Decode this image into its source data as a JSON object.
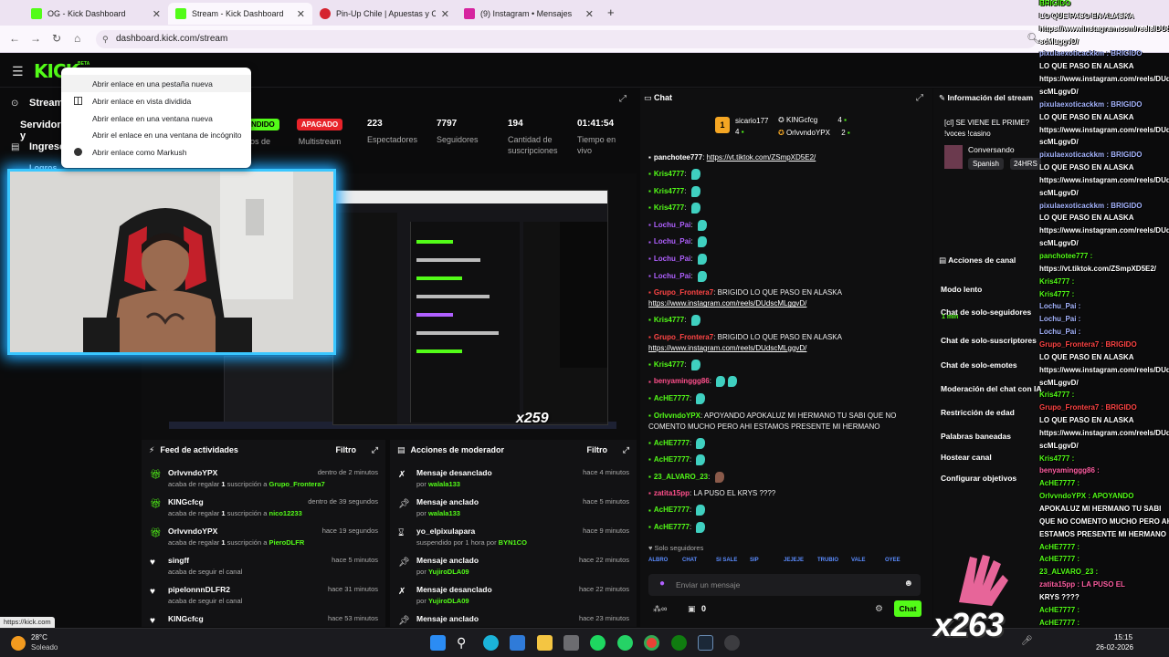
{
  "browser": {
    "tabs": [
      {
        "title": "OG - Kick Dashboard",
        "color": "#53fc18"
      },
      {
        "title": "Stream - Kick Dashboard",
        "color": "#53fc18"
      },
      {
        "title": "Pin-Up Chile | Apuestas y Casin",
        "color": "#d5232f"
      },
      {
        "title": "(9) Instagram • Mensajes",
        "color": "#d6249f"
      }
    ],
    "new_tab": "+",
    "url": "dashboard.kick.com/stream"
  },
  "kick": {
    "logo": "KICK",
    "logo_badge": "BETA",
    "sidebar": [
      "Stream",
      "Servidor y",
      "Ingresos",
      "Logros"
    ]
  },
  "context_menu": {
    "items": [
      "Abrir enlace en una pestaña nueva",
      "Abrir enlace en vista dividida",
      "Abrir enlace en una ventana nueva",
      "Abrir el enlace en una ventana de incógnito",
      "Abrir enlace como Markush"
    ]
  },
  "stats": {
    "partial_status": "NDIDO",
    "partial_label": "os de",
    "multistream_badge": "APAGADO",
    "multistream_label": "Multistream",
    "viewers": "223",
    "viewers_label": "Espectadores",
    "followers": "7797",
    "followers_label": "Seguidores",
    "subs": "194",
    "subs_label": "Cantidad de suscripciones",
    "uptime": "01:41:54",
    "uptime_label": "Tiempo en vivo"
  },
  "preview": {
    "overlay_counter": "x259"
  },
  "activity_feed": {
    "title": "Feed de actividades",
    "filter": "Filtro",
    "items": [
      {
        "user": "OrlvvndoYPX",
        "time": "dentro de 2 minutos",
        "text": "acaba de regalar ",
        "bold": "1",
        "text2": " suscripción a ",
        "target": "Grupo_Frontera7",
        "icon": "gift-icon"
      },
      {
        "user": "KINGcfcg",
        "time": "dentro de 39 segundos",
        "text": "acaba de regalar ",
        "bold": "1",
        "text2": " suscripción a ",
        "target": "nico12233",
        "icon": "gift-icon"
      },
      {
        "user": "OrlvvndoYPX",
        "time": "hace 19 segundos",
        "text": "acaba de regalar ",
        "bold": "1",
        "text2": " suscripción a ",
        "target": "PieroDLFR",
        "icon": "gift-icon"
      },
      {
        "user": "singff",
        "time": "hace 5 minutos",
        "text": "acaba de seguir el canal",
        "bold": "",
        "text2": "",
        "target": "",
        "icon": "heart-icon"
      },
      {
        "user": "pipelonnnDLFR2",
        "time": "hace 31 minutos",
        "text": "acaba de seguir el canal",
        "bold": "",
        "text2": "",
        "target": "",
        "icon": "heart-icon"
      },
      {
        "user": "KINGcfcg",
        "time": "hace 53 minutos",
        "text": "",
        "bold": "",
        "text2": "",
        "target": "",
        "icon": "heart-icon"
      }
    ]
  },
  "mod_actions": {
    "title": "Acciones de moderador",
    "filter": "Filtro",
    "items": [
      {
        "title": "Mensaje desanclado",
        "time": "hace 4 minutos",
        "by": "por ",
        "user": "walala133",
        "icon": "unpin-icon"
      },
      {
        "title": "Mensaje anclado",
        "time": "hace 5 minutos",
        "by": "por ",
        "user": "walala133",
        "icon": "pin-icon"
      },
      {
        "title": "yo_elpixulapara",
        "time": "hace 9 minutos",
        "by": "suspendido por 1 hora por ",
        "user": "BYN1CO",
        "icon": "hourglass-icon"
      },
      {
        "title": "Mensaje anclado",
        "time": "hace 22 minutos",
        "by": "por ",
        "user": "YujiroDLA09",
        "icon": "pin-icon"
      },
      {
        "title": "Mensaje desanclado",
        "time": "hace 22 minutos",
        "by": "por ",
        "user": "YujiroDLA09",
        "icon": "unpin-icon"
      },
      {
        "title": "Mensaje anclado",
        "time": "hace 23 minutos",
        "by": "",
        "user": "",
        "icon": "pin-icon"
      }
    ]
  },
  "chat": {
    "title": "Chat",
    "top_gifters": [
      {
        "name": "sicario177",
        "count": "4"
      },
      {
        "name": "KINGcfcg",
        "count": "4"
      },
      {
        "name": "OrlvvndoYPX",
        "count": "2"
      }
    ],
    "top_rank": "1",
    "lines": [
      {
        "user": "panchotee777",
        "color": "#ffffff",
        "sep": ": ",
        "text": "https://vt.tiktok.com/ZSmpXD5E2/",
        "link": true,
        "emotes": 0
      },
      {
        "user": "Kris4777",
        "color": "#53fc18",
        "sep": ": ",
        "text": "",
        "link": false,
        "emotes": 1
      },
      {
        "user": "Kris4777",
        "color": "#53fc18",
        "sep": ": ",
        "text": "",
        "link": false,
        "emotes": 1
      },
      {
        "user": "Kris4777",
        "color": "#53fc18",
        "sep": ": ",
        "text": "",
        "link": false,
        "emotes": 1
      },
      {
        "user": "Lochu_Pai",
        "color": "#b060ff",
        "sep": ": ",
        "text": "",
        "link": false,
        "emotes": 1
      },
      {
        "user": "Lochu_Pai",
        "color": "#b060ff",
        "sep": ": ",
        "text": "",
        "link": false,
        "emotes": 1
      },
      {
        "user": "Lochu_Pai",
        "color": "#b060ff",
        "sep": ": ",
        "text": "",
        "link": false,
        "emotes": 1
      },
      {
        "user": "Lochu_Pai",
        "color": "#b060ff",
        "sep": ": ",
        "text": "",
        "link": false,
        "emotes": 1
      },
      {
        "user": "Grupo_Frontera7",
        "color": "#ff4545",
        "sep": ": ",
        "text": "BRIGIDO LO QUE PASO EN ALASKA",
        "text2": "https://www.instagram.com/reels/DUdscMLggvD/",
        "link": false,
        "emotes": 0
      },
      {
        "user": "Kris4777",
        "color": "#53fc18",
        "sep": ": ",
        "text": "",
        "link": false,
        "emotes": 1
      },
      {
        "user": "Grupo_Frontera7",
        "color": "#ff4545",
        "sep": ": ",
        "text": "BRIGIDO LO QUE PASO EN ALASKA",
        "text2": "https://www.instagram.com/reels/DUdscMLggvD/",
        "link": false,
        "emotes": 0
      },
      {
        "user": "Kris4777",
        "color": "#53fc18",
        "sep": ": ",
        "text": "",
        "link": false,
        "emotes": 1
      },
      {
        "user": "benyaminggg86",
        "color": "#ff4f8b",
        "sep": ": ",
        "text": "",
        "link": false,
        "emotes": 1
      },
      {
        "user": "AcHE7777",
        "color": "#53fc18",
        "sep": ": ",
        "text": "",
        "link": false,
        "emotes": 1
      },
      {
        "user": "OrlvvndoYPX",
        "color": "#53fc18",
        "sep": ": ",
        "text": "APOYANDO APOKALUZ MI HERMANO TU SABI QUE NO",
        "text2": "COMENTO MUCHO PERO AHI ESTAMOS PRESENTE MI HERMANO",
        "link": false,
        "emotes": 0
      },
      {
        "user": "AcHE7777",
        "color": "#53fc18",
        "sep": ": ",
        "text": "",
        "link": false,
        "emotes": 1
      },
      {
        "user": "AcHE7777",
        "color": "#53fc18",
        "sep": ": ",
        "text": "",
        "link": false,
        "emotes": 1
      },
      {
        "user": "23_ALVARO_23",
        "color": "#53fc18",
        "sep": ": ",
        "text": "",
        "link": false,
        "emotes": 1
      },
      {
        "user": "zatita15pp",
        "color": "#ff4f8b",
        "sep": ": ",
        "text": "LA PUSO EL KRYS ????",
        "link": false,
        "emotes": 0
      },
      {
        "user": "AcHE7777",
        "color": "#53fc18",
        "sep": ": ",
        "text": "",
        "link": false,
        "emotes": 1
      },
      {
        "user": "AcHE7777",
        "color": "#53fc18",
        "sep": ": ",
        "text": "",
        "link": false,
        "emotes": 1
      }
    ],
    "followers_only": "Solo seguidores",
    "emote_row": [
      "ALBRO",
      "CHAT",
      "SI SALE",
      "SIP",
      "JEJEJE",
      "TRUBIO",
      "VALE",
      "OYEE"
    ],
    "input_placeholder": "Enviar un mensaje",
    "viewers_small": "0",
    "send": "Chat"
  },
  "info": {
    "title": "Información del stream",
    "stream_title": "[cl] SE VIENE EL PRIME? !voces !casino",
    "category": "Conversando",
    "language": "Spanish",
    "tag": "24HRS",
    "actions_title": "Acciones de canal",
    "actions": [
      "Modo lento",
      "Chat de solo-seguidores",
      "Chat de solo-suscriptores",
      "Chat de solo-emotes",
      "Moderación del chat con IA",
      "Restricción de edad",
      "Palabras baneadas",
      "Hostear canal",
      "Configurar objetivos"
    ],
    "followers_only_value": "1 min"
  },
  "overlay_chat": [
    {
      "u": "BRIGIDO",
      "c": "gr"
    },
    {
      "u": "LO QUE PASO EN ALASKA",
      "c": ""
    },
    {
      "u": "https://www.instagram.com/reels/DUd",
      "c": ""
    },
    {
      "u": "scMLggvD/",
      "c": ""
    },
    {
      "u": "pixulaexoticackkm : BRIGIDO",
      "c": "bl"
    },
    {
      "u": "LO QUE PASO EN ALASKA",
      "c": ""
    },
    {
      "u": "https://www.instagram.com/reels/DUd",
      "c": ""
    },
    {
      "u": "scMLggvD/",
      "c": ""
    },
    {
      "u": "pixulaexoticackkm : BRIGIDO",
      "c": "bl"
    },
    {
      "u": "LO QUE PASO EN ALASKA",
      "c": ""
    },
    {
      "u": "https://www.instagram.com/reels/DUd",
      "c": ""
    },
    {
      "u": "scMLggvD/",
      "c": ""
    },
    {
      "u": "pixulaexoticackkm : BRIGIDO",
      "c": "bl"
    },
    {
      "u": "LO QUE PASO EN ALASKA",
      "c": ""
    },
    {
      "u": "https://www.instagram.com/reels/DUd",
      "c": ""
    },
    {
      "u": "scMLggvD/",
      "c": ""
    },
    {
      "u": "pixulaexoticackkm : BRIGIDO",
      "c": "bl"
    },
    {
      "u": "LO QUE PASO EN ALASKA",
      "c": ""
    },
    {
      "u": "https://www.instagram.com/reels/DUd",
      "c": ""
    },
    {
      "u": "scMLggvD/",
      "c": ""
    },
    {
      "u": "panchotee777 :",
      "c": "gr"
    },
    {
      "u": "https://vt.tiktok.com/ZSmpXD5E2/",
      "c": ""
    },
    {
      "u": "Kris4777 :",
      "c": "gr"
    },
    {
      "u": "Kris4777 :",
      "c": "gr"
    },
    {
      "u": "Lochu_Pai :",
      "c": "bl"
    },
    {
      "u": "Lochu_Pai :",
      "c": "bl"
    },
    {
      "u": "Lochu_Pai :",
      "c": "bl"
    },
    {
      "u": "Grupo_Frontera7 : BRIGIDO",
      "c": "rd"
    },
    {
      "u": "LO QUE PASO EN ALASKA",
      "c": ""
    },
    {
      "u": "https://www.instagram.com/reels/DUd",
      "c": ""
    },
    {
      "u": "scMLggvD/",
      "c": ""
    },
    {
      "u": "Kris4777 :",
      "c": "gr"
    },
    {
      "u": "Grupo_Frontera7 : BRIGIDO",
      "c": "rd"
    },
    {
      "u": "LO QUE PASO EN ALASKA",
      "c": ""
    },
    {
      "u": "https://www.instagram.com/reels/DUd",
      "c": ""
    },
    {
      "u": "scMLggvD/",
      "c": ""
    },
    {
      "u": "Kris4777 :",
      "c": "gr"
    },
    {
      "u": "benyaminggg86 :",
      "c": "pk"
    },
    {
      "u": "AcHE7777 :",
      "c": "gr"
    },
    {
      "u": "OrlvvndoYPX : APOYANDO",
      "c": "gr"
    },
    {
      "u": "APOKALUZ MI HERMANO TU SABI",
      "c": ""
    },
    {
      "u": "QUE NO COMENTO MUCHO PERO AHI",
      "c": ""
    },
    {
      "u": "ESTAMOS PRESENTE MI HERMANO",
      "c": ""
    },
    {
      "u": "AcHE7777 :",
      "c": "gr"
    },
    {
      "u": "AcHE7777 :",
      "c": "gr"
    },
    {
      "u": "23_ALVARO_23 :",
      "c": "gr"
    },
    {
      "u": "zatita15pp : LA PUSO EL",
      "c": "pk"
    },
    {
      "u": "KRYS ????",
      "c": ""
    },
    {
      "u": "AcHE7777 :",
      "c": "gr"
    },
    {
      "u": "AcHE7777 :",
      "c": "gr"
    }
  ],
  "overlay_counter": "x263",
  "statusbar_url": "https://kick.com",
  "taskbar": {
    "weather_temp": "28°C",
    "weather_text": "Soleado",
    "time": "15:15",
    "date": "26-02-2026"
  }
}
